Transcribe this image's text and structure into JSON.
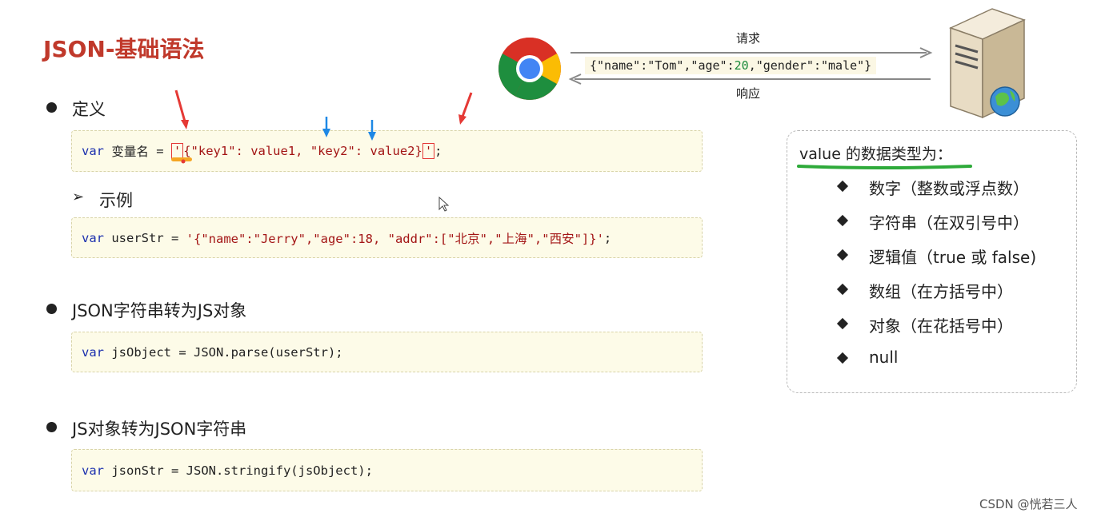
{
  "slide": {
    "title": "JSON-基础语法"
  },
  "sections": {
    "definition": {
      "heading": "定义",
      "code": {
        "var": "var",
        "name": "变量名",
        "eq": " = ",
        "quote_open": "'",
        "body": "{\"key1\": value1, \"key2\": value2}",
        "quote_close": "'",
        "semi": ";"
      }
    },
    "example": {
      "heading": "示例",
      "code": {
        "var": "var",
        "rest": " userStr = ",
        "str": "'{\"name\":\"Jerry\",\"age\":18, \"addr\":[\"北京\",\"上海\",\"西安\"]}'",
        "semi": ";"
      }
    },
    "to_object": {
      "heading": "JSON字符串转为JS对象",
      "code": {
        "var": "var",
        "rest": " jsObject = JSON.parse(userStr);"
      }
    },
    "to_string": {
      "heading": "JS对象转为JSON字符串",
      "code": {
        "var": "var",
        "rest": " jsonStr = JSON.stringify(jsObject);"
      }
    }
  },
  "diagram": {
    "request_label": "请求",
    "response_label": "响应",
    "json_example": {
      "p1": "{\"name\":\"Tom\",\"age\":",
      "age": "20",
      "p2": ",\"gender\":\"male\"}"
    }
  },
  "types_panel": {
    "title": "value 的数据类型为：",
    "items": [
      "数字（整数或浮点数）",
      "字符串（在双引号中）",
      "逻辑值（true 或 false)",
      "数组（在方括号中）",
      "对象（在花括号中）",
      "null"
    ]
  },
  "watermark": "CSDN @恍若三人",
  "colors": {
    "title": "#c0392b",
    "keyword": "#1b2fae",
    "string": "#a31515",
    "number": "#1a8a3a",
    "code_bg": "#fdfbe8",
    "underline_green": "#2eaa3a",
    "annotation_red": "#e53935",
    "annotation_blue": "#1e88e5"
  }
}
